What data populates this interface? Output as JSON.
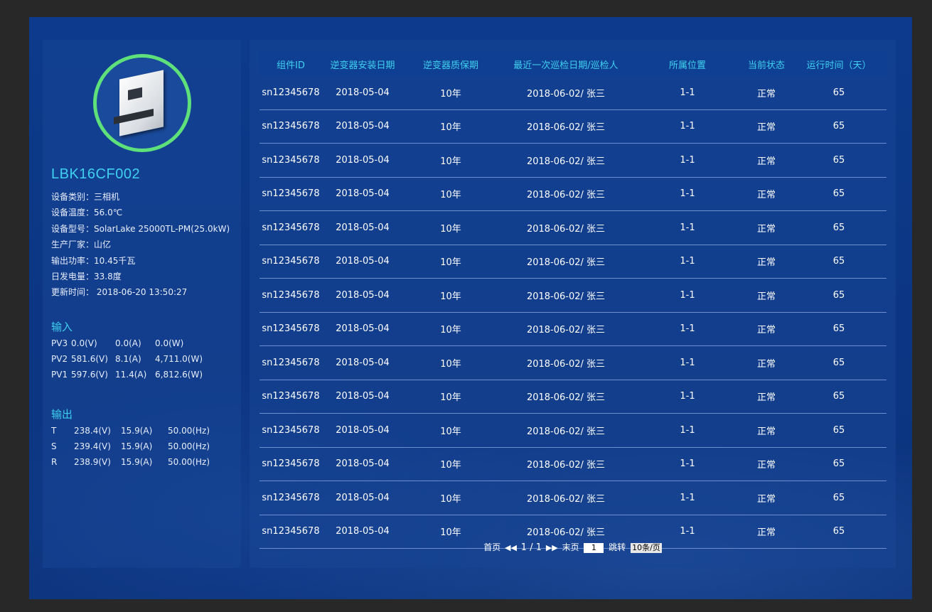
{
  "device": {
    "name": "LBK16CF002",
    "specs": [
      "设备类别：三相机",
      "设备温度：56.0℃",
      "设备型号：SolarLake 25000TL-PM(25.0kW)",
      "生产厂家：山亿",
      "输出功率：10.45千瓦",
      "日发电量：33.8度",
      "更新时间：  2018-06-20 13:50:27"
    ]
  },
  "input": {
    "title": "输入",
    "rows": [
      {
        "name": "PV3",
        "v": "0.0(V)",
        "a": "0.0(A)",
        "w": "0.0(W)"
      },
      {
        "name": "PV2",
        "v": "581.6(V)",
        "a": "8.1(A)",
        "w": "4,711.0(W)"
      },
      {
        "name": "PV1",
        "v": "597.6(V)",
        "a": "11.4(A)",
        "w": "6,812.6(W)"
      }
    ]
  },
  "output": {
    "title": "输出",
    "rows": [
      {
        "name": "T",
        "v": "238.4(V)",
        "a": "15.9(A)",
        "hz": "50.00(Hz)"
      },
      {
        "name": "S",
        "v": "239.4(V)",
        "a": "15.9(A)",
        "hz": "50.00(Hz)"
      },
      {
        "name": "R",
        "v": "238.9(V)",
        "a": "15.9(A)",
        "hz": "50.00(Hz)"
      }
    ]
  },
  "table": {
    "headers": [
      "组件ID",
      "逆变器安装日期",
      "逆变器质保期",
      "最近一次巡检日期/巡检人",
      "所属位置",
      "当前状态",
      "运行时间（天）"
    ],
    "rows": [
      [
        "sn12345678",
        "2018-05-04",
        "10年",
        "2018-06-02/ 张三",
        "1-1",
        "正常",
        "65"
      ],
      [
        "sn12345678",
        "2018-05-04",
        "10年",
        "2018-06-02/ 张三",
        "1-1",
        "正常",
        "65"
      ],
      [
        "sn12345678",
        "2018-05-04",
        "10年",
        "2018-06-02/ 张三",
        "1-1",
        "正常",
        "65"
      ],
      [
        "sn12345678",
        "2018-05-04",
        "10年",
        "2018-06-02/ 张三",
        "1-1",
        "正常",
        "65"
      ],
      [
        "sn12345678",
        "2018-05-04",
        "10年",
        "2018-06-02/ 张三",
        "1-1",
        "正常",
        "65"
      ],
      [
        "sn12345678",
        "2018-05-04",
        "10年",
        "2018-06-02/ 张三",
        "1-1",
        "正常",
        "65"
      ],
      [
        "sn12345678",
        "2018-05-04",
        "10年",
        "2018-06-02/ 张三",
        "1-1",
        "正常",
        "65"
      ],
      [
        "sn12345678",
        "2018-05-04",
        "10年",
        "2018-06-02/ 张三",
        "1-1",
        "正常",
        "65"
      ],
      [
        "sn12345678",
        "2018-05-04",
        "10年",
        "2018-06-02/ 张三",
        "1-1",
        "正常",
        "65"
      ],
      [
        "sn12345678",
        "2018-05-04",
        "10年",
        "2018-06-02/ 张三",
        "1-1",
        "正常",
        "65"
      ],
      [
        "sn12345678",
        "2018-05-04",
        "10年",
        "2018-06-02/ 张三",
        "1-1",
        "正常",
        "65"
      ],
      [
        "sn12345678",
        "2018-05-04",
        "10年",
        "2018-06-02/ 张三",
        "1-1",
        "正常",
        "65"
      ],
      [
        "sn12345678",
        "2018-05-04",
        "10年",
        "2018-06-02/ 张三",
        "1-1",
        "正常",
        "65"
      ],
      [
        "sn12345678",
        "2018-05-04",
        "10年",
        "2018-06-02/ 张三",
        "1-1",
        "正常",
        "65"
      ]
    ]
  },
  "pager": {
    "first": "首页",
    "prev_icon": "rewind-icon",
    "page_info": "1 / 1",
    "next_icon": "fast-forward-icon",
    "last": "末页",
    "page_input": "1",
    "jump": "跳转",
    "page_size": "10条/页"
  },
  "colors": {
    "accent": "#3fd0ef",
    "ring": "#5ee07a",
    "background": "#0d3a8c"
  }
}
